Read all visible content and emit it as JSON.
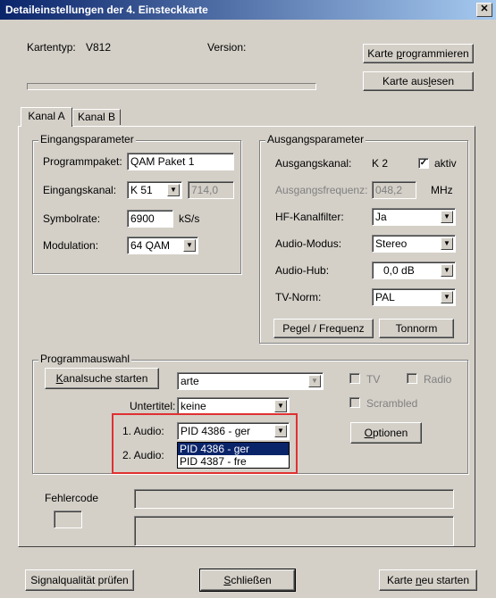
{
  "window": {
    "title": "Detaileinstellungen der 4. Einsteckkarte",
    "close_glyph": "✕"
  },
  "header": {
    "kartentyp_label": "Kartentyp:",
    "kartentyp_value": "V812",
    "version_label": "Version:",
    "progress_value": 0
  },
  "buttons": {
    "program_pre": "Karte ",
    "program_acc": "p",
    "program_post": "rogrammieren",
    "read_pre": "Karte aus",
    "read_acc": "l",
    "read_post": "esen",
    "pegel": "Pegel / Frequenz",
    "tonnorm": "Tonnorm",
    "search_pre": "",
    "search_acc": "K",
    "search_post": "analsuche starten",
    "optionen_pre": "",
    "optionen_acc": "O",
    "optionen_post": "ptionen",
    "signal": "Signalqualität prüfen",
    "close_pre": "",
    "close_acc": "S",
    "close_post": "chließen",
    "restart_pre": "Karte ",
    "restart_acc": "n",
    "restart_post": "eu starten"
  },
  "tabs": [
    "Kanal A",
    "Kanal B"
  ],
  "input": {
    "title": "Eingangsparameter",
    "programmpaket_label": "Programmpaket:",
    "programmpaket_value": "QAM Paket 1",
    "eingangskanal_label": "Eingangskanal:",
    "eingangskanal_value": "K 51",
    "eingangskanal_freq": "714,0",
    "symbolrate_label": "Symbolrate:",
    "symbolrate_value": "6900",
    "symbolrate_unit": "kS/s",
    "modulation_label": "Modulation:",
    "modulation_value": "64 QAM"
  },
  "output": {
    "title": "Ausgangsparameter",
    "ausgangskanal_label": "Ausgangskanal:",
    "ausgangskanal_value": "K 2",
    "aktiv_label": "aktiv",
    "aktiv_checked": true,
    "ausgangsfrequenz_label": "Ausgangsfrequenz:",
    "ausgangsfrequenz_value": "048,2",
    "ausgangsfrequenz_unit": "MHz",
    "hf_label": "HF-Kanalfilter:",
    "hf_value": "Ja",
    "audiomodus_label": "Audio-Modus:",
    "audiomodus_value": "Stereo",
    "audiohub_label": "Audio-Hub:",
    "audiohub_value": "0,0 dB",
    "tvnorm_label": "TV-Norm:",
    "tvnorm_value": "PAL"
  },
  "program": {
    "title": "Programmauswahl",
    "program_value": "arte",
    "tv_label": "TV",
    "radio_label": "Radio",
    "scrambled_label": "Scrambled",
    "untertitel_label": "Untertitel:",
    "untertitel_value": "keine",
    "audio1_label": "1. Audio:",
    "audio1_value": "PID 4386 - ger",
    "audio2_label": "2. Audio:",
    "audio_options": [
      "PID 4386 - ger",
      "PID 4387 - fre"
    ],
    "audio_selected_index": 0
  },
  "error": {
    "label": "Fehlercode"
  },
  "colors": {
    "highlight": "#e03030",
    "selection": "#0a246a",
    "face": "#d4d0c8"
  },
  "icons": {
    "dropdown": "chevron-down-icon",
    "close": "close-icon",
    "check": "check-icon"
  }
}
